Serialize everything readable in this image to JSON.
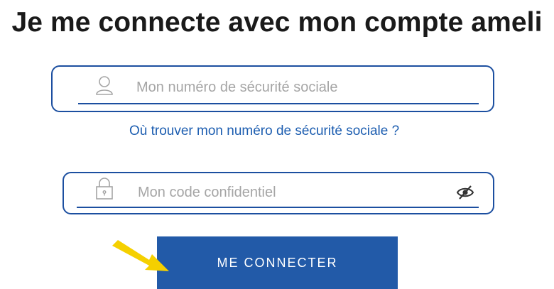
{
  "heading": "Je me connecte avec mon compte ameli",
  "nir_field": {
    "placeholder": "Mon numéro de sécurité sociale",
    "value": "",
    "icon": "user-icon"
  },
  "help_link": {
    "label": "Où trouver mon numéro de sécurité sociale ?"
  },
  "password_field": {
    "placeholder": "Mon code confidentiel",
    "value": "",
    "icon": "padlock-icon",
    "toggle_icon": "eye-off-icon"
  },
  "submit": {
    "label": "ME CONNECTER"
  },
  "colors": {
    "accent": "#225aa8",
    "border": "#1c4fa0",
    "link": "#1c5db0",
    "placeholder": "#a5a5a5",
    "pointer_arrow": "#f5d000"
  }
}
